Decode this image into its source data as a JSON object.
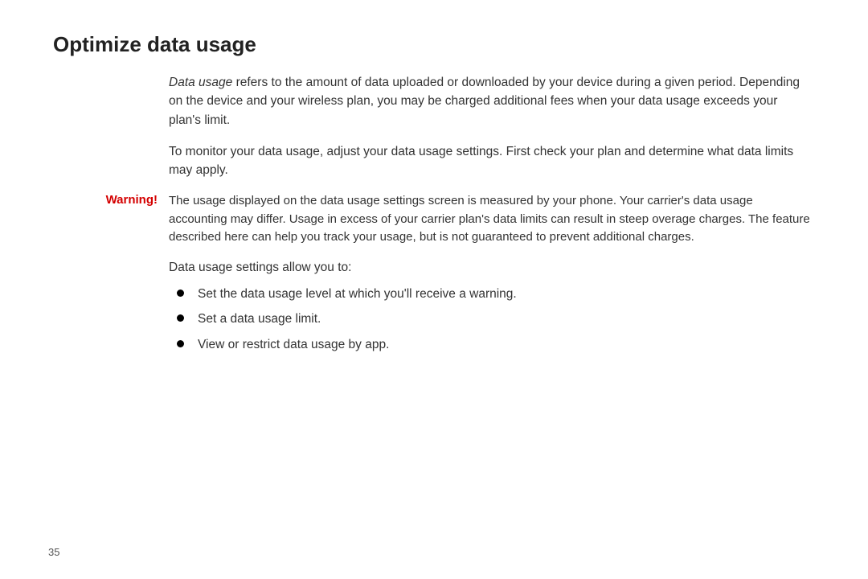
{
  "title": "Optimize data usage",
  "intro": {
    "term": "Data usage",
    "para1_rest": " refers to the amount of data uploaded or downloaded by your device during a given period. Depending on the device and your wireless plan, you may be charged additional fees when your data usage exceeds your plan's limit.",
    "para2": "To monitor your data usage, adjust your data usage settings. First check your plan and determine what data limits may apply."
  },
  "warning": {
    "label": "Warning!",
    "text": "The usage displayed on the data usage settings screen is measured by your phone. Your carrier's data usage accounting may differ. Usage in excess of your carrier plan's data limits can result in steep overage charges. The feature described here can help you track your usage, but is not guaranteed to prevent additional charges."
  },
  "settings_intro": "Data usage settings allow you to:",
  "bullets": [
    "Set the data usage level at which you'll receive a warning.",
    "Set a data usage limit.",
    "View or restrict data usage by app."
  ],
  "page_number": "35"
}
